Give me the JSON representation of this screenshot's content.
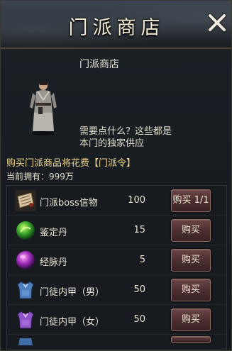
{
  "window": {
    "title": "门派商店"
  },
  "npc": {
    "shop_name": "门派商店",
    "dialog": "需要点什么？这些都是本门的独家供应"
  },
  "info": {
    "cost_text": "购买门派商品将花费【门派令】",
    "owned_label": "当前拥有：",
    "owned_value": "999万"
  },
  "items": [
    {
      "name": "门派boss信物",
      "price": "100",
      "buy_label": "购买 1/1",
      "icon": "scroll-icon"
    },
    {
      "name": "鉴定丹",
      "price": "15",
      "buy_label": "购买",
      "icon": "green-pill-icon"
    },
    {
      "name": "经脉丹",
      "price": "5",
      "buy_label": "购买",
      "icon": "purple-pill-icon"
    },
    {
      "name": "门徒内甲（男）",
      "price": "50",
      "buy_label": "购买",
      "icon": "blue-armor-icon"
    },
    {
      "name": "门徒内甲（女）",
      "price": "50",
      "buy_label": "购买",
      "icon": "purple-armor-icon"
    }
  ],
  "colors": {
    "accent_gold": "#f2d58b",
    "button_red": "#4a2d2f"
  }
}
